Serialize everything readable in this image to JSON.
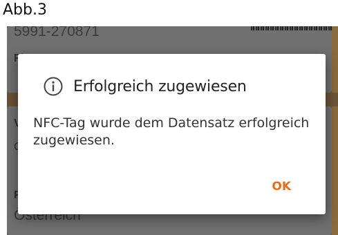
{
  "caption": "Abb.3",
  "background": {
    "record_number": "5991-270871",
    "label_1": "Fi",
    "label_2": "V",
    "label_3": "C",
    "label_4": "F",
    "country_value": "Österreich"
  },
  "dialog": {
    "icon": "info-icon",
    "title": "Erfolgreich zugewiesen",
    "message": "NFC-Tag wurde dem Datensatz erfolgreich zugewiesen.",
    "ok_label": "OK"
  },
  "colors": {
    "accent": "#e0701f",
    "overlay": "#5b5b5b",
    "card_edge": "#8a6a3a"
  }
}
